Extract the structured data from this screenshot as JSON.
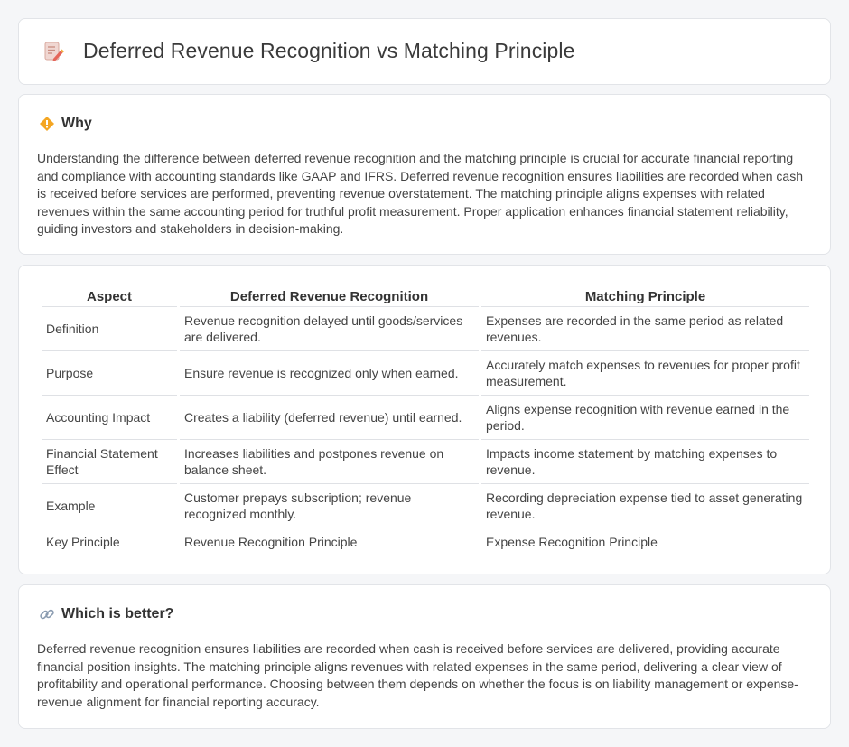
{
  "header": {
    "title": "Deferred Revenue Recognition vs Matching Principle",
    "icon": "document-pencil-icon"
  },
  "why": {
    "title": "Why",
    "icon": "diamond-warning-icon",
    "text": "Understanding the difference between deferred revenue recognition and the matching principle is crucial for accurate financial reporting and compliance with accounting standards like GAAP and IFRS. Deferred revenue recognition ensures liabilities are recorded when cash is received before services are performed, preventing revenue overstatement. The matching principle aligns expenses with related revenues within the same accounting period for truthful profit measurement. Proper application enhances financial statement reliability, guiding investors and stakeholders in decision-making."
  },
  "table": {
    "headers": [
      "Aspect",
      "Deferred Revenue Recognition",
      "Matching Principle"
    ],
    "rows": [
      [
        "Definition",
        "Revenue recognition delayed until goods/services are delivered.",
        "Expenses are recorded in the same period as related revenues."
      ],
      [
        "Purpose",
        "Ensure revenue is recognized only when earned.",
        "Accurately match expenses to revenues for proper profit measurement."
      ],
      [
        "Accounting Impact",
        "Creates a liability (deferred revenue) until earned.",
        "Aligns expense recognition with revenue earned in the period."
      ],
      [
        "Financial Statement Effect",
        "Increases liabilities and postpones revenue on balance sheet.",
        "Impacts income statement by matching expenses to revenue."
      ],
      [
        "Example",
        "Customer prepays subscription; revenue recognized monthly.",
        "Recording depreciation expense tied to asset generating revenue."
      ],
      [
        "Key Principle",
        "Revenue Recognition Principle",
        "Expense Recognition Principle"
      ]
    ]
  },
  "better": {
    "title": "Which is better?",
    "icon": "link-icon",
    "text": "Deferred revenue recognition ensures liabilities are recorded when cash is received before services are delivered, providing accurate financial position insights. The matching principle aligns revenues with related expenses in the same period, delivering a clear view of profitability and operational performance. Choosing between them depends on whether the focus is on liability management or expense-revenue alignment for financial reporting accuracy."
  }
}
